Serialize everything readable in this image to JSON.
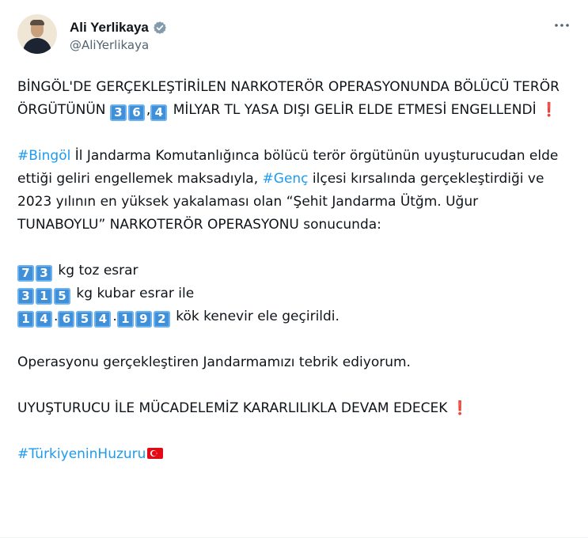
{
  "author": {
    "name": "Ali Yerlikaya",
    "handle": "@AliYerlikaya"
  },
  "icons": {
    "verified": "verified-badge-icon",
    "more": "more-options-icon",
    "flag": "turkey-flag-icon"
  },
  "colors": {
    "link": "#1d9bf0",
    "text": "#0f1419",
    "muted": "#536471",
    "keycap": "#3f8fd9"
  },
  "tweet": {
    "headline_a": "BİNGÖL'DE GERÇEKLEŞTİRİLEN NARKOTERÖR OPERASYONUNDA BÖLÜCÜ TERÖR ÖRGÜTÜNÜN ",
    "headline_digits_1": [
      "3",
      "6"
    ],
    "headline_sep": ",",
    "headline_digits_2": [
      "4"
    ],
    "headline_b": " MİLYAR TL YASA DIŞI GELİR ELDE ETMESİ ENGELLENDİ ",
    "excl_1": "❗",
    "hashtag_1": "#Bingöl",
    "para2_a": " İl Jandarma Komutanlığınca bölücü terör örgütünün uyuşturucudan elde ettiği geliri engellemek maksadıyla, ",
    "hashtag_2": "#Genç",
    "para2_b": " ilçesi kırsalında gerçekleştirdiği ve 2023 yılının en yüksek yakalaması olan “Şehit Jandarma Ütğm. Uğur TUNABOYLU” NARKOTERÖR OPERASYONU sonucunda:",
    "line1_digits": [
      "7",
      "3"
    ],
    "line1_text": " kg toz esrar",
    "line2_digits": [
      "3",
      "1",
      "5"
    ],
    "line2_text": " kg kubar esrar ile",
    "line3_group1": [
      "1",
      "4"
    ],
    "line3_sep": ".",
    "line3_group2": [
      "6",
      "5",
      "4"
    ],
    "line3_group3": [
      "1",
      "9",
      "2"
    ],
    "line3_text": " kök kenevir ele geçirildi.",
    "congrats": "Operasyonu gerçekleştiren Jandarmamızı tebrik ediyorum.",
    "closing": "UYUŞTURUCU İLE MÜCADELEMİZ KARARLILIKLA DEVAM EDECEK ",
    "excl_2": "❗",
    "hashtag_3": "#TürkiyeninHuzuru"
  }
}
